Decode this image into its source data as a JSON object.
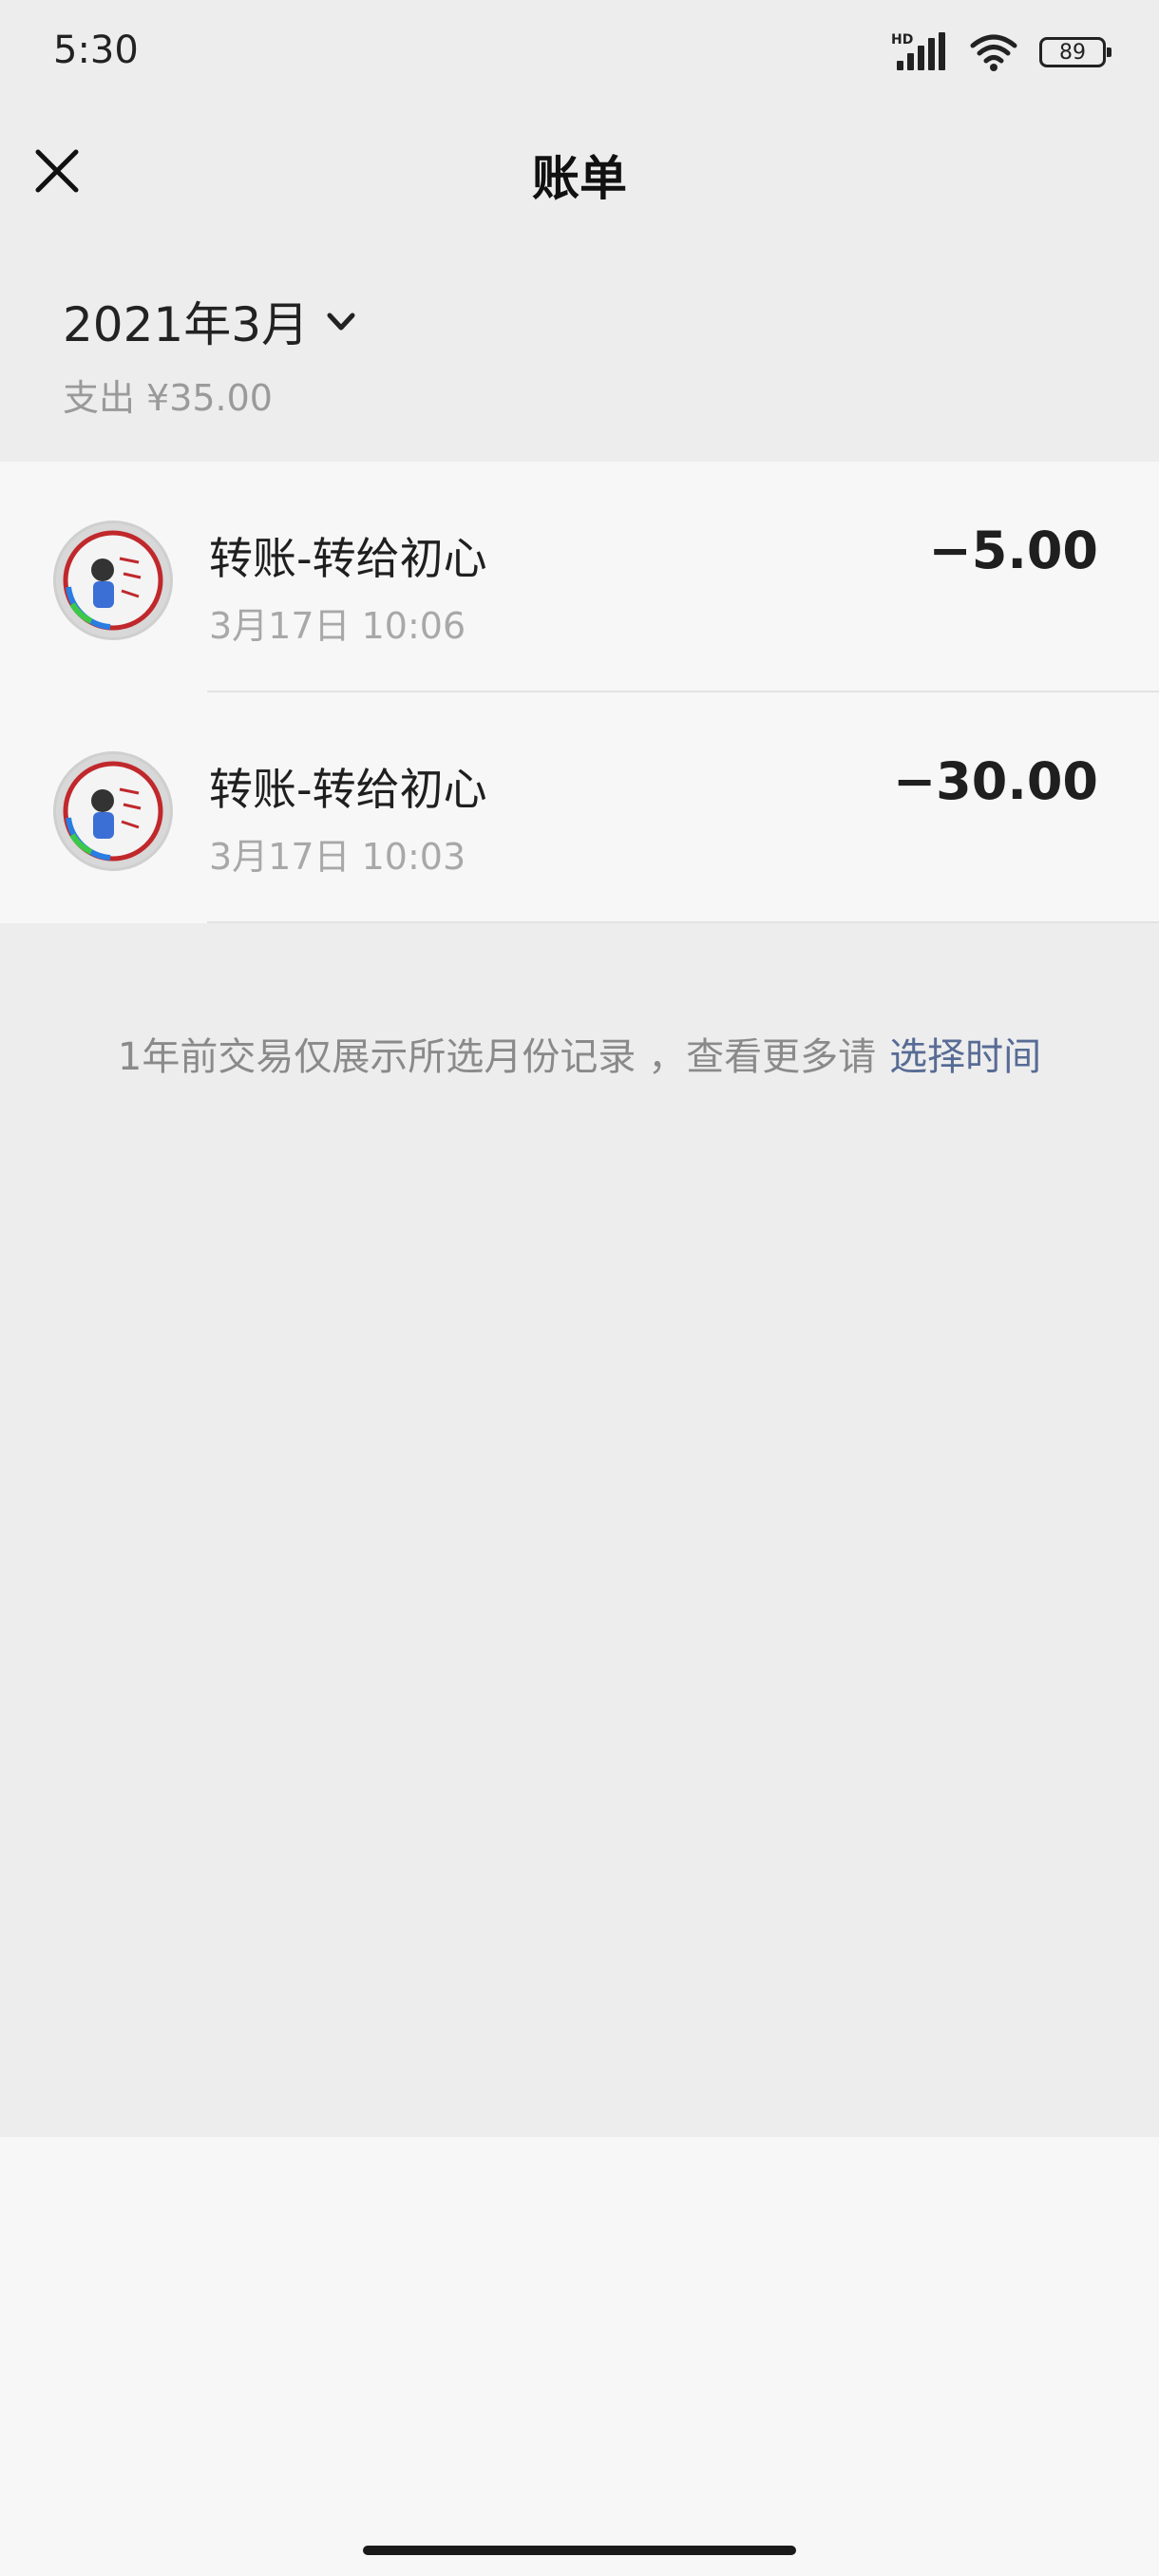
{
  "status_bar": {
    "time": "5:30",
    "network_label": "HD",
    "battery": "89"
  },
  "nav": {
    "title": "账单",
    "close_icon": "close-icon"
  },
  "month": {
    "label": "2021年3月",
    "chevron_icon": "chevron-down-icon",
    "total_label": "支出",
    "total_amount": "¥35.00"
  },
  "transactions": [
    {
      "title": "转账-转给初心",
      "time": "3月17日 10:06",
      "amount": "−5.00",
      "avatar_icon": "avatar-image"
    },
    {
      "title": "转账-转给初心",
      "time": "3月17日 10:03",
      "amount": "−30.00",
      "avatar_icon": "avatar-image"
    }
  ],
  "footer": {
    "note": "1年前交易仅展示所选月份记录 ，查看更多请",
    "link": "选择时间"
  },
  "colors": {
    "background": "#ededed",
    "card": "#f7f7f7",
    "link": "#576b95",
    "secondary_text": "#a8a8a8"
  }
}
